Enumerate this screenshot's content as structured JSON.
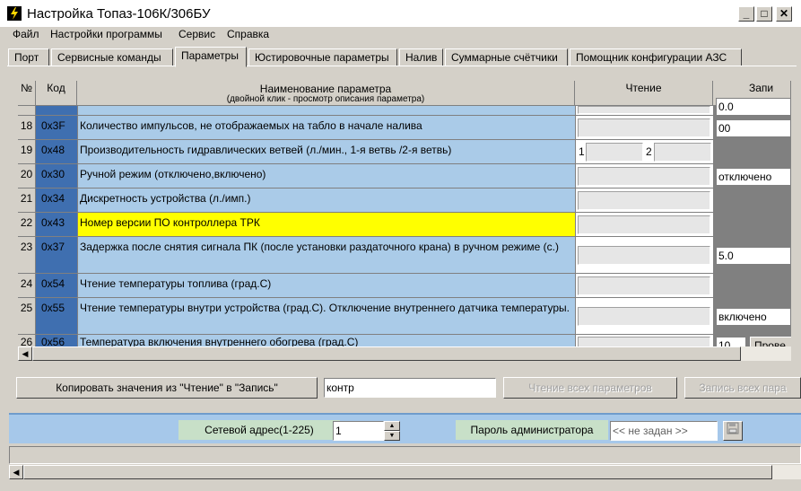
{
  "window": {
    "title": "Настройка Топаз-106К/306БУ",
    "minimize": "_",
    "maximize": "□",
    "close": "✕"
  },
  "menu": [
    "Файл",
    "Настройки программы",
    "Сервис",
    "Справка"
  ],
  "tabs": [
    "Порт",
    "Сервисные команды",
    "Параметры",
    "Юстировочные параметры",
    "Налив",
    "Суммарные счётчики",
    "Помощник конфигурации АЗС"
  ],
  "active_tab": "Параметры",
  "grid": {
    "headers": {
      "num": "№",
      "code": "Код",
      "name": "Наименование параметра",
      "name_sub": "(двойной клик - просмотр описания параметра)",
      "read": "Чтение",
      "write": "Запи"
    },
    "partial_top_write": "0.0",
    "rows": [
      {
        "num": "18",
        "code": "0x3F",
        "name": "Количество импульсов, не отображаемых на табло в начале налива",
        "write": "00"
      },
      {
        "num": "19",
        "code": "0x48",
        "name": "Производительность гидравлических ветвей (л./мин., 1-я ветвь /2-я ветвь)",
        "read_label1": "1",
        "read_label2": "2",
        "write": ""
      },
      {
        "num": "20",
        "code": "0x30",
        "name": "Ручной режим (отключено,включено)",
        "write": "отключено"
      },
      {
        "num": "21",
        "code": "0x34",
        "name": "Дискретность устройства (л./имп.)",
        "write": ""
      },
      {
        "num": "22",
        "code": "0x43",
        "name": "Номер версии ПО контроллера ТРК",
        "write": ""
      },
      {
        "num": "23",
        "code": "0x37",
        "name": "Задержка после снятия сигнала ПК (после установки раздаточного крана) в ручном режиме (с.)",
        "write": "5.0"
      },
      {
        "num": "24",
        "code": "0x54",
        "name": "Чтение температуры топлива (град.С)",
        "write": ""
      },
      {
        "num": "25",
        "code": "0x55",
        "name": "Чтение температуры внутри устройства (град.С). Отключение внутреннего датчика температуры.",
        "write": "включено"
      },
      {
        "num": "26",
        "code": "0x56",
        "name": "Температура включения внутреннего обогрева (град.С)",
        "write": "10",
        "write_extra": "Прове"
      }
    ]
  },
  "actions": {
    "copy_button": "Копировать значения  из \"Чтение\" в \"Запись\"",
    "search_value": "контр",
    "read_all_button": "Чтение всех параметров",
    "write_all_button": "Запись всех пара"
  },
  "bottom": {
    "net_label": "Сетевой адрес(1-225)",
    "net_value": "1",
    "pwd_label": "Пароль администратора",
    "pwd_value": "<< не задан >>"
  },
  "colors": {
    "code_col": "#3f6fb0",
    "name_col": "#aacbe8",
    "highlight": "#ffff00",
    "bottom_bar": "#a6c8ea"
  }
}
